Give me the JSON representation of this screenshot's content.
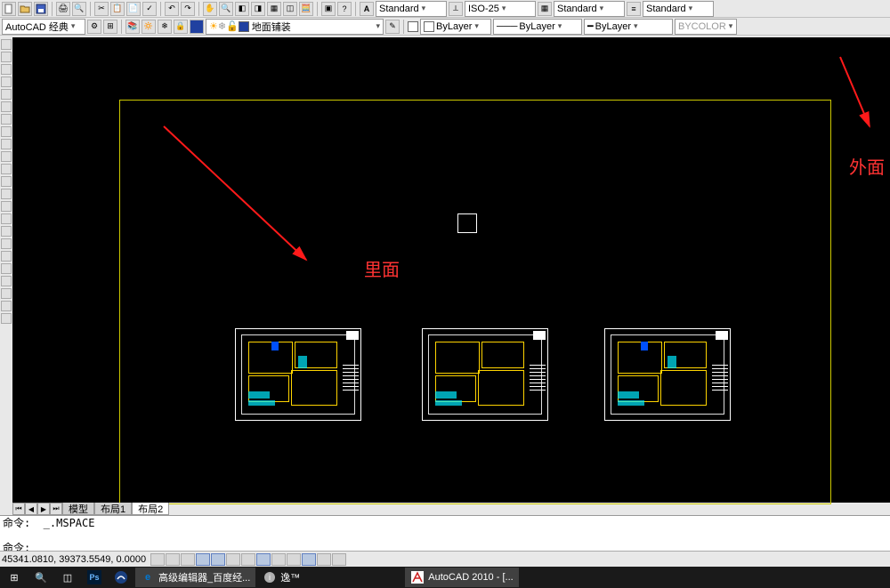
{
  "toolbar_row1": {
    "workspace_dd": "AutoCAD 经典",
    "layer_dd": "地面铺装"
  },
  "toolbar_row2": {
    "text_style": "Standard",
    "dim_style": "ISO-25",
    "table_style": "Standard",
    "ml_style": "Standard",
    "prop1": "ByLayer",
    "prop2": "ByLayer",
    "prop3": "ByLayer",
    "bycolor": "BYCOLOR"
  },
  "tabs": {
    "model": "模型",
    "layout1": "布局1",
    "layout2": "布局2",
    "active": "布局2"
  },
  "annotations": {
    "inside": "里面",
    "outside": "外面"
  },
  "command": {
    "prompt_prefix": "命令: ",
    "history_line": "命令:  _.MSPACE",
    "current_line": "命令: "
  },
  "status": {
    "coords": "45341.0810, 39373.5549, 0.0000"
  },
  "win_taskbar": {
    "edge_item": "高级编辑器_百度经...",
    "ie_item": "逸™",
    "autocad_item": "AutoCAD 2010 - [..."
  }
}
